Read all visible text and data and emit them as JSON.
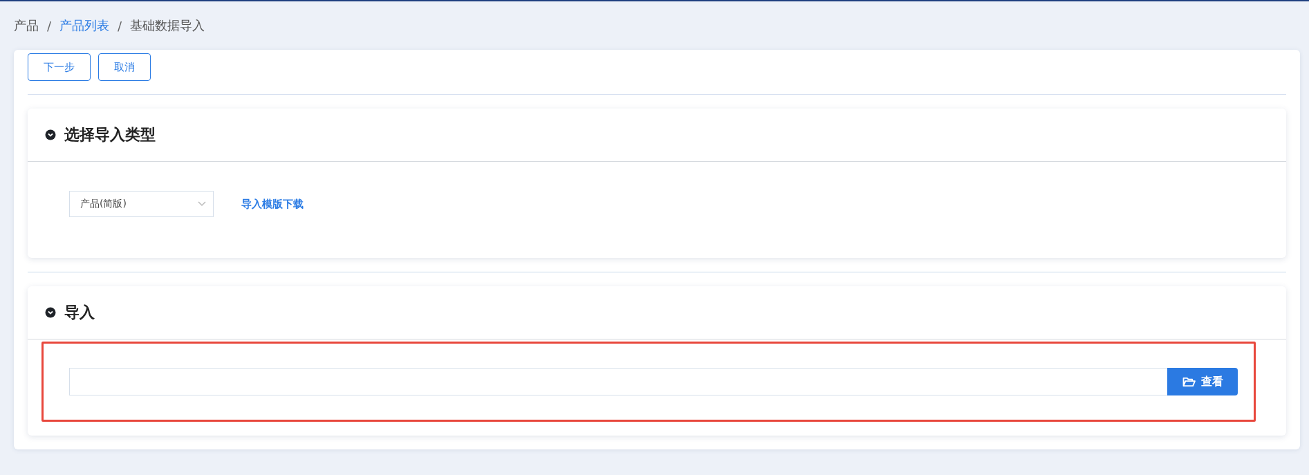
{
  "breadcrumb": {
    "separator": "/",
    "items": [
      {
        "label": "产品",
        "link": false
      },
      {
        "label": "产品列表",
        "link": true
      },
      {
        "label": "基础数据导入",
        "link": false
      }
    ]
  },
  "actions": [
    {
      "label": "下一步"
    },
    {
      "label": "取消"
    }
  ],
  "sections": [
    {
      "kind": "type-select",
      "title": "选择导入类型",
      "expanded": true,
      "select": {
        "value": "产品(简版)"
      },
      "link": "导入模版下载"
    },
    {
      "kind": "file-upload",
      "title": "导入",
      "expanded": true,
      "highlighted": true,
      "button": "查看"
    }
  ]
}
